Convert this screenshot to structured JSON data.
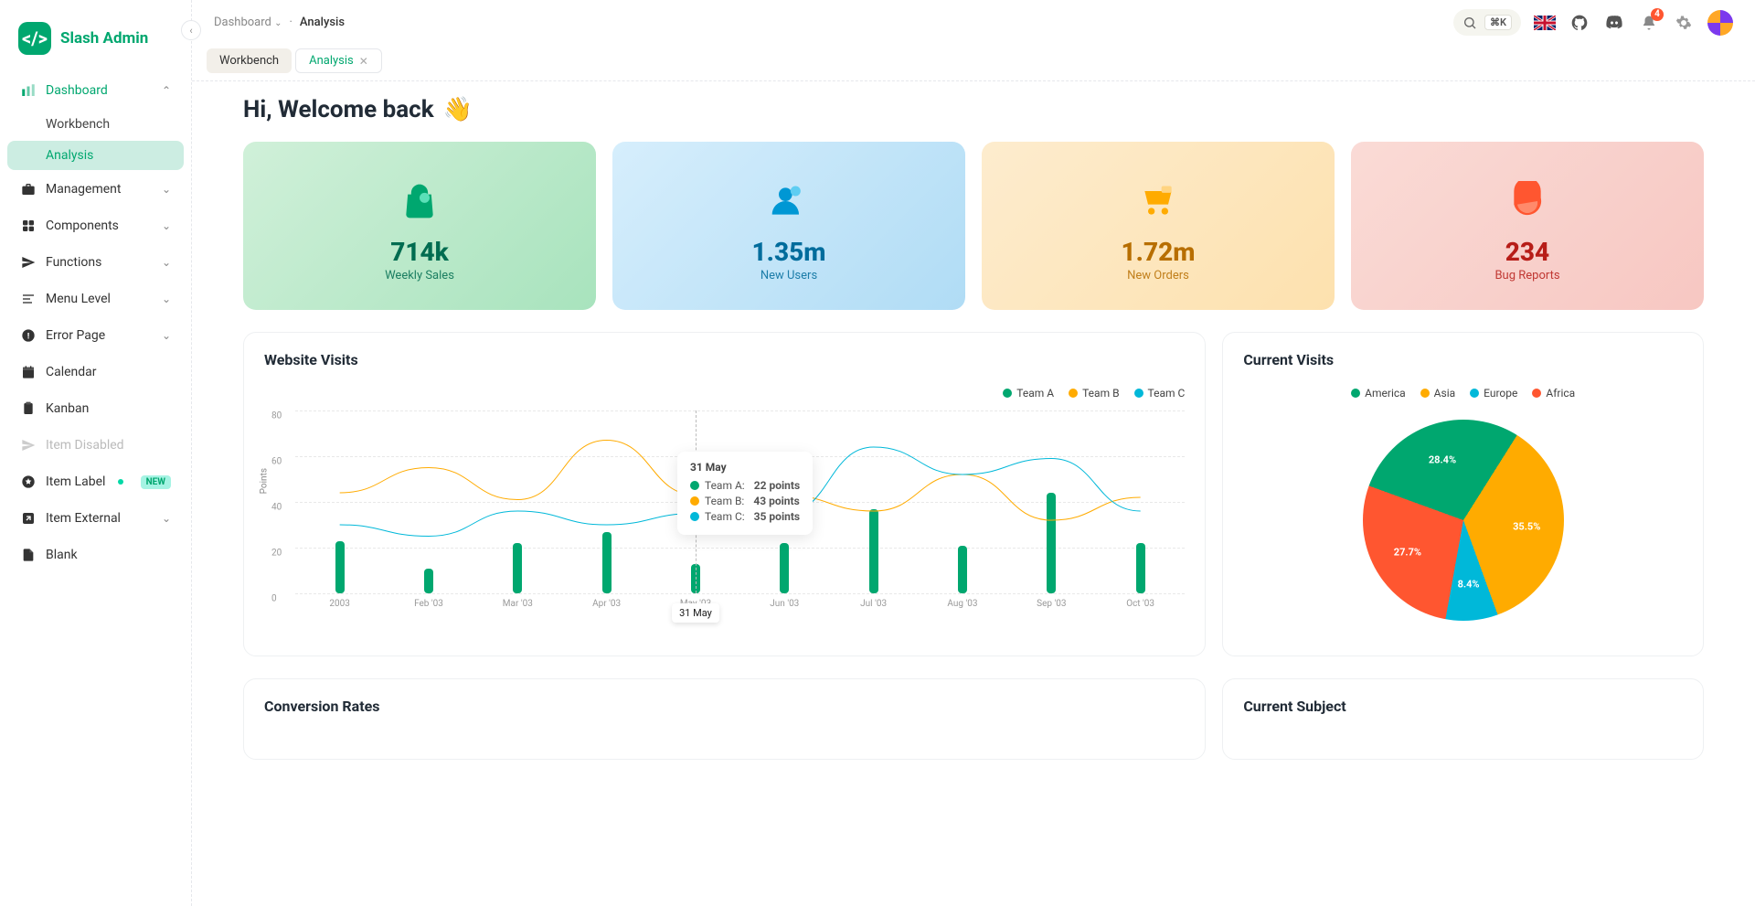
{
  "app": {
    "name": "Slash Admin"
  },
  "breadcrumb": {
    "parent": "Dashboard",
    "current": "Analysis"
  },
  "search": {
    "shortcut": "⌘K"
  },
  "notifications": {
    "count": 4
  },
  "tabs": [
    {
      "label": "Workbench",
      "active": false,
      "closeable": false
    },
    {
      "label": "Analysis",
      "active": true,
      "closeable": true
    }
  ],
  "sidebar": {
    "dashboard": "Dashboard",
    "workbench": "Workbench",
    "analysis": "Analysis",
    "management": "Management",
    "components": "Components",
    "functions": "Functions",
    "menu_level": "Menu Level",
    "error_page": "Error Page",
    "calendar": "Calendar",
    "kanban": "Kanban",
    "item_disabled": "Item Disabled",
    "item_label": "Item Label",
    "item_label_badge": "NEW",
    "item_external": "Item External",
    "blank": "Blank"
  },
  "welcome": "Hi, Welcome back",
  "stats": [
    {
      "value": "714k",
      "label": "Weekly Sales"
    },
    {
      "value": "1.35m",
      "label": "New Users"
    },
    {
      "value": "1.72m",
      "label": "New Orders"
    },
    {
      "value": "234",
      "label": "Bug Reports"
    }
  ],
  "website_visits": {
    "title": "Website Visits"
  },
  "current_visits": {
    "title": "Current Visits"
  },
  "conversion_rates": {
    "title": "Conversion Rates"
  },
  "current_subject": {
    "title": "Current Subject"
  },
  "tooltip": {
    "title": "31 May",
    "rows": [
      {
        "name": "Team A:",
        "value": "22 points"
      },
      {
        "name": "Team B:",
        "value": "43 points"
      },
      {
        "name": "Team C:",
        "value": "35 points"
      }
    ],
    "xlabel": "31 May"
  },
  "chart_data": {
    "website_visits": {
      "type": "line+bar",
      "ylabel": "Points",
      "ylim": [
        0,
        80
      ],
      "yticks": [
        0,
        20,
        40,
        60,
        80
      ],
      "categories": [
        "2003",
        "Feb '03",
        "Mar '03",
        "Apr '03",
        "May '03",
        "Jun '03",
        "Jul '03",
        "Aug '03",
        "Sep '03",
        "Oct '03"
      ],
      "series": [
        {
          "name": "Team A",
          "type": "bar",
          "color": "#00a76f",
          "values": [
            23,
            11,
            22,
            27,
            13,
            22,
            37,
            21,
            44,
            22
          ]
        },
        {
          "name": "Team B",
          "type": "line",
          "color": "#ffab00",
          "values": [
            44,
            55,
            41,
            67,
            43,
            43,
            36,
            52,
            32,
            42
          ]
        },
        {
          "name": "Team C",
          "type": "line",
          "color": "#00b8d9",
          "values": [
            30,
            25,
            36,
            30,
            35,
            35,
            64,
            52,
            59,
            36
          ]
        }
      ],
      "tooltip_index": 4
    },
    "current_visits": {
      "type": "pie",
      "series": [
        {
          "name": "America",
          "value": 28.4,
          "color": "#00a76f"
        },
        {
          "name": "Asia",
          "value": 35.5,
          "color": "#ffab00"
        },
        {
          "name": "Europe",
          "value": 8.4,
          "color": "#00b8d9"
        },
        {
          "name": "Africa",
          "value": 27.7,
          "color": "#ff5630"
        }
      ]
    }
  }
}
